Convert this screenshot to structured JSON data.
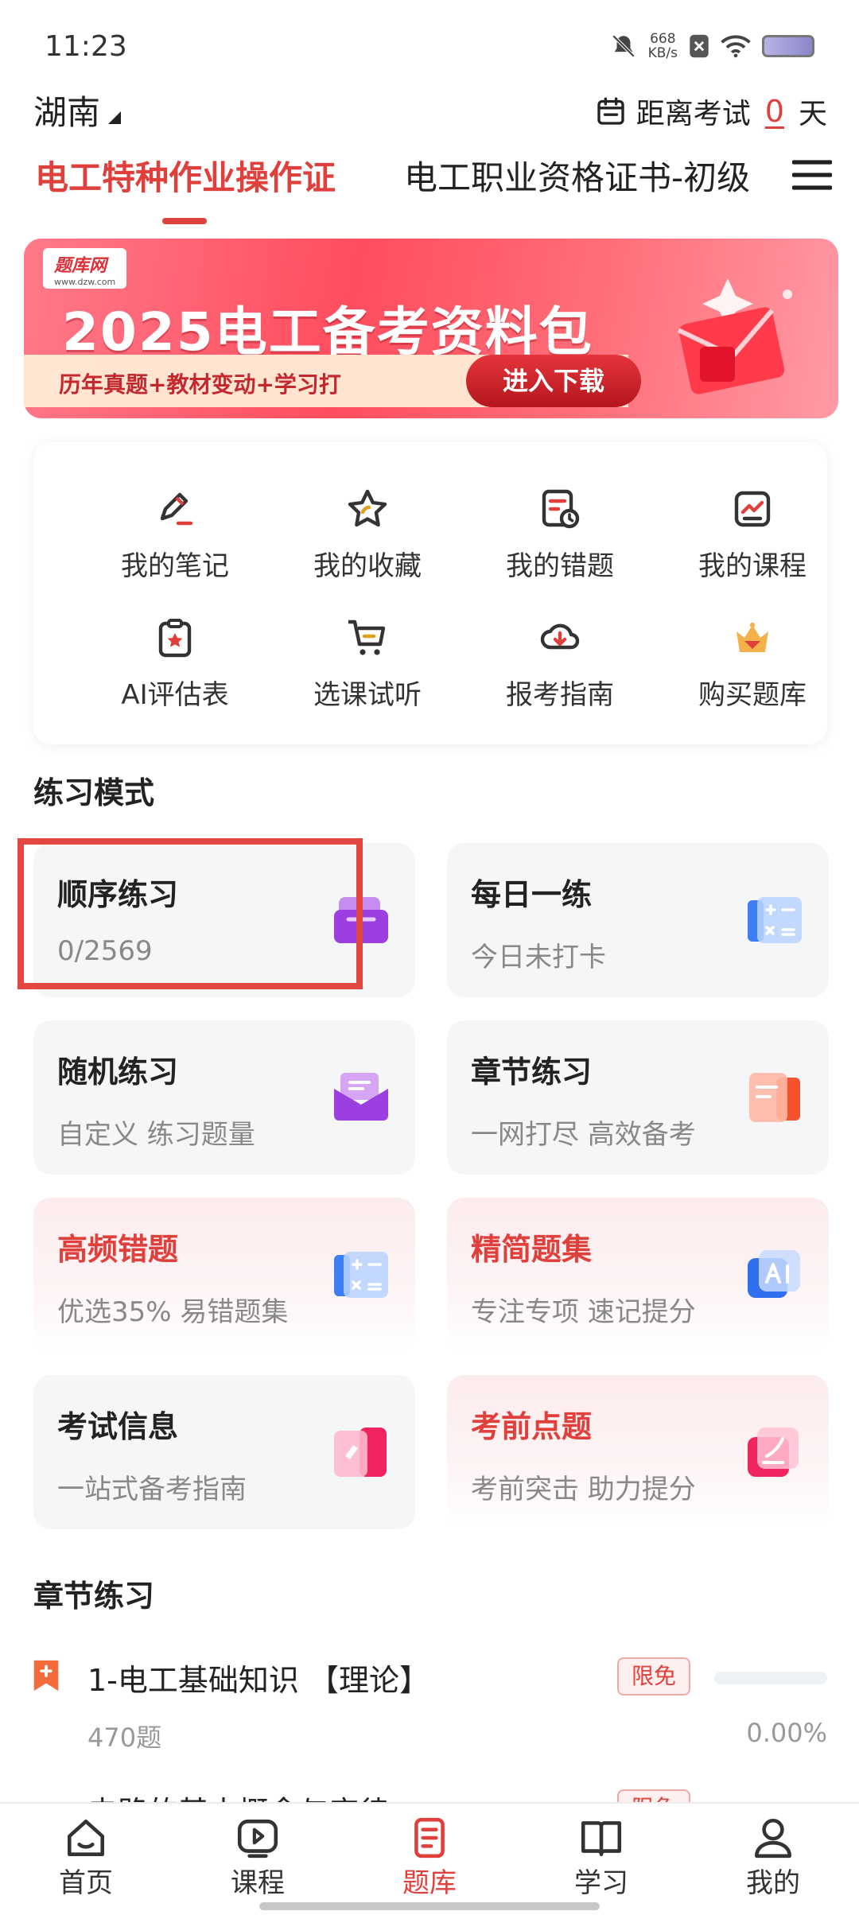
{
  "status_bar": {
    "time": "11:23",
    "net_speed_value": "668",
    "net_speed_unit": "KB/s"
  },
  "header": {
    "region": "湖南",
    "countdown_prefix": "距离考试",
    "countdown_days": "0",
    "countdown_suffix": "天"
  },
  "tabs": [
    {
      "label": "电工特种作业操作证",
      "active": true
    },
    {
      "label": "电工职业资格证书-初级",
      "active": false
    }
  ],
  "banner": {
    "logo_text": "题库网",
    "logo_url_text": "www.dzw.com",
    "title": "2025电工备考资料包",
    "subtitle": "历年真题+教材变动+学习打",
    "button_label": "进入下载"
  },
  "quick_grid": [
    {
      "label": "我的笔记",
      "icon": "note-pen-icon"
    },
    {
      "label": "我的收藏",
      "icon": "star-icon"
    },
    {
      "label": "我的错题",
      "icon": "wrong-questions-icon"
    },
    {
      "label": "我的课程",
      "icon": "course-chart-icon"
    },
    {
      "label": "AI评估表",
      "icon": "clipboard-star-icon"
    },
    {
      "label": "选课试听",
      "icon": "cart-icon"
    },
    {
      "label": "报考指南",
      "icon": "cloud-download-icon"
    },
    {
      "label": "购买题库",
      "icon": "crown-icon"
    }
  ],
  "practice_section": {
    "title": "练习模式",
    "cards": [
      {
        "title": "顺序练习",
        "subtitle": "0/2569",
        "icon": "purple-box-icon",
        "style": "gray"
      },
      {
        "title": "每日一练",
        "subtitle": "今日未打卡",
        "icon": "blue-calculator-icon",
        "style": "gray"
      },
      {
        "title": "随机练习",
        "subtitle": "自定义 练习题量",
        "icon": "purple-envelope-icon",
        "style": "gray"
      },
      {
        "title": "章节练习",
        "subtitle": "一网打尽 高效备考",
        "icon": "orange-document-icon",
        "style": "gray"
      },
      {
        "title": "高频错题",
        "subtitle": "优选35% 易错题集",
        "icon": "blue-calculator-icon",
        "style": "pink"
      },
      {
        "title": "精简题集",
        "subtitle": "专注专项 速记提分",
        "icon": "ai-icon",
        "style": "pink"
      },
      {
        "title": "考试信息",
        "subtitle": "一站式备考指南",
        "icon": "pink-card-icon",
        "style": "gray"
      },
      {
        "title": "考前点题",
        "subtitle": "考前突击 助力提分",
        "icon": "pink-pen-icon",
        "style": "pink"
      }
    ]
  },
  "chapter_section": {
    "title": "章节练习",
    "items": [
      {
        "title": "1-电工基础知识 【理论】",
        "badge": "限免",
        "count": "470题",
        "percent": "0.00%",
        "progress": 0
      },
      {
        "title": "电路的基本概念与定律",
        "badge": "限免"
      }
    ]
  },
  "bottom_nav": [
    {
      "label": "首页",
      "icon": "home-icon",
      "active": false
    },
    {
      "label": "课程",
      "icon": "play-course-icon",
      "active": false
    },
    {
      "label": "题库",
      "icon": "question-bank-icon",
      "active": true
    },
    {
      "label": "学习",
      "icon": "book-icon",
      "active": false
    },
    {
      "label": "我的",
      "icon": "profile-icon",
      "active": false
    }
  ],
  "colors": {
    "accent": "#e0403c",
    "card_gray": "#f5f6f8",
    "card_pink": "#fdeced",
    "highlight_border": "#e4473f"
  }
}
